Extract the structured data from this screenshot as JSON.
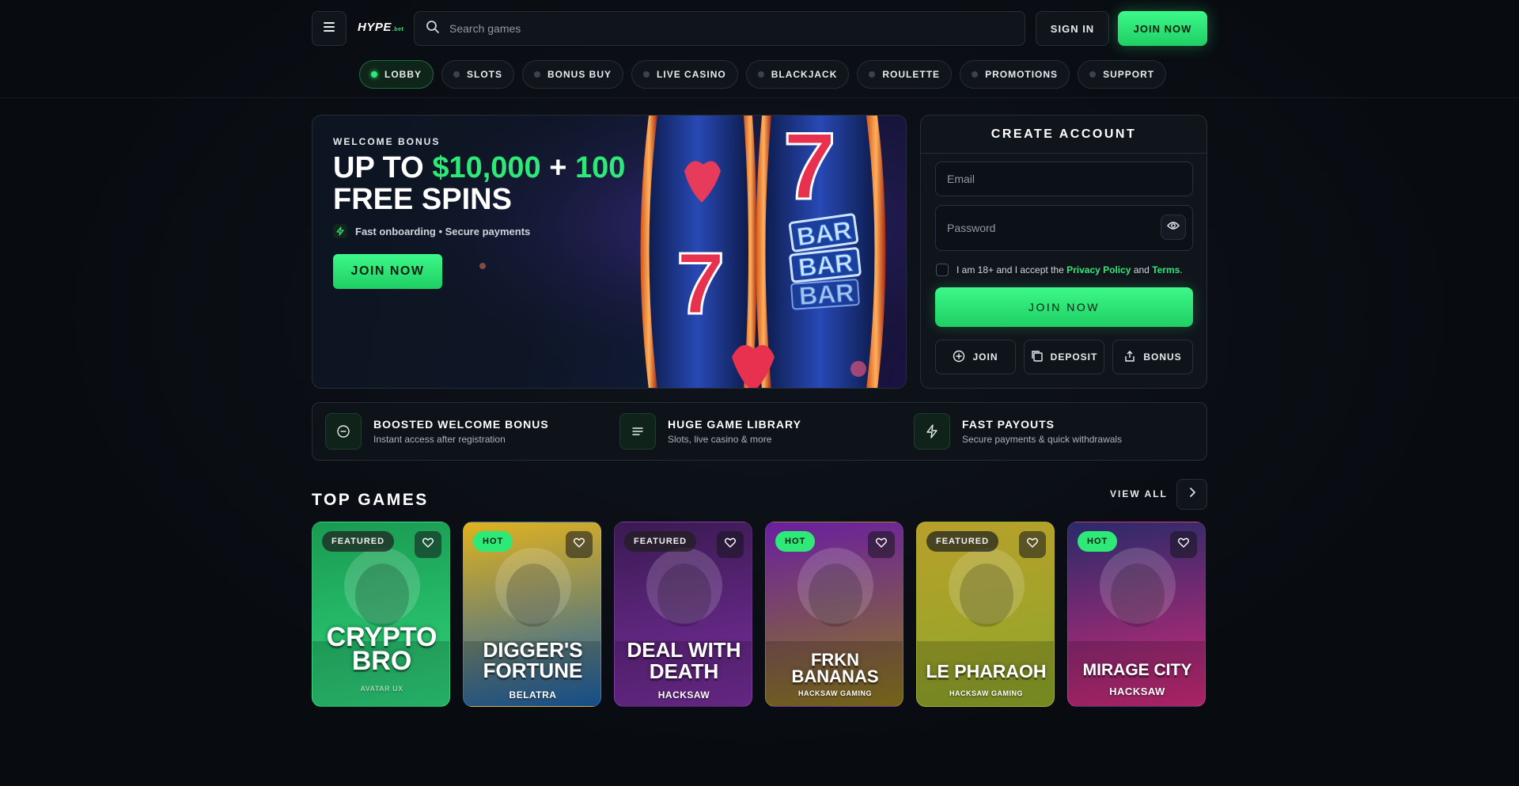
{
  "header": {
    "logo": "HYPE",
    "logo_suffix": ".bet",
    "search_placeholder": "Search games",
    "signin_label": "SIGN IN",
    "join_label": "JOIN NOW",
    "accent_color": "#2ee878"
  },
  "nav": {
    "items": [
      {
        "label": "LOBBY",
        "active": true
      },
      {
        "label": "SLOTS",
        "active": false
      },
      {
        "label": "BONUS BUY",
        "active": false
      },
      {
        "label": "LIVE CASINO",
        "active": false
      },
      {
        "label": "BLACKJACK",
        "active": false
      },
      {
        "label": "ROULETTE",
        "active": false
      },
      {
        "label": "PROMOTIONS",
        "active": false
      },
      {
        "label": "SUPPORT",
        "active": false
      }
    ]
  },
  "hero": {
    "eyebrow": "WELCOME BONUS",
    "title_prefix": "UP TO ",
    "title_amount": "$10,000",
    "title_plus": " + ",
    "title_spins": "100",
    "title_suffix": "FREE SPINS",
    "subtitle": "Fast onboarding • Secure payments",
    "cta_label": "JOIN NOW",
    "art_text": [
      "BAR",
      "BAR",
      "BAR"
    ]
  },
  "account": {
    "title": "CREATE ACCOUNT",
    "email_placeholder": "Email",
    "password_placeholder": "Password",
    "consent_prefix": "I am 18+ and I accept the ",
    "privacy_label": "Privacy Policy",
    "consent_and": " and ",
    "terms_label": "Terms",
    "consent_end": ".",
    "submit_label": "JOIN NOW",
    "quick_actions": [
      {
        "label": "JOIN",
        "icon": "plus-circle-icon"
      },
      {
        "label": "DEPOSIT",
        "icon": "copy-icon"
      },
      {
        "label": "BONUS",
        "icon": "share-icon"
      }
    ]
  },
  "features": [
    {
      "title": "BOOSTED WELCOME BONUS",
      "desc": "Instant access after registration",
      "icon": "minus-circle-icon"
    },
    {
      "title": "HUGE GAME LIBRARY",
      "desc": "Slots, live casino & more",
      "icon": "lines-icon"
    },
    {
      "title": "FAST PAYOUTS",
      "desc": "Secure payments & quick withdrawals",
      "icon": "bolt-icon"
    }
  ],
  "top_games": {
    "title": "TOP GAMES",
    "view_all_label": "VIEW ALL",
    "games": [
      {
        "badge": "FEATURED",
        "name": "CRYPTO\nBRO",
        "provider": "AVATAR UX",
        "bg1": "#1a9a52",
        "bg2": "#2fd57c"
      },
      {
        "badge": "HOT",
        "name": "DIGGER'S\nFORTUNE",
        "provider": "BELATRA",
        "bg1": "#e0b21f",
        "bg2": "#1b5fa8"
      },
      {
        "badge": "FEATURED",
        "name": "DEAL WITH\nDEATH",
        "provider": "HACKSAW",
        "bg1": "#3a1a52",
        "bg2": "#7b2fa0"
      },
      {
        "badge": "HOT",
        "name": "FRKN\nBANANAS",
        "provider": "HACKSAW GAMING",
        "bg1": "#6a1fa0",
        "bg2": "#8c7a1c"
      },
      {
        "badge": "FEATURED",
        "name": "LE PHARAOH",
        "provider": "HACKSAW GAMING",
        "bg1": "#b8a02a",
        "bg2": "#8da62a"
      },
      {
        "badge": "HOT",
        "name": "MIRAGE CITY",
        "provider": "HACKSAW",
        "bg1": "#2a2a6a",
        "bg2": "#d12a7a"
      }
    ]
  }
}
